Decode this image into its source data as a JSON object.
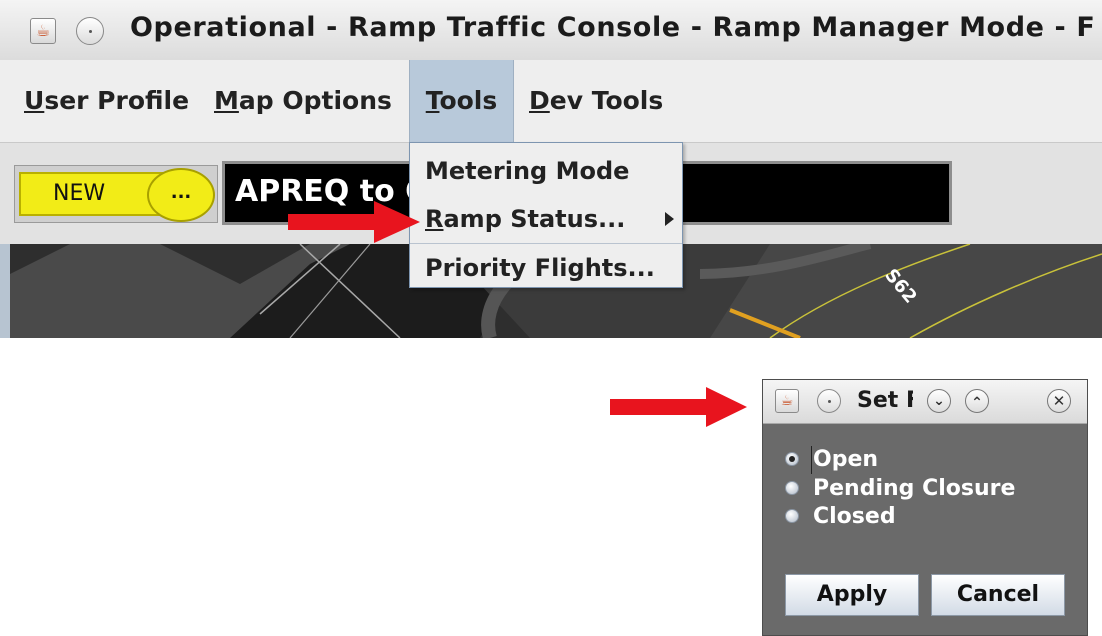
{
  "console": {
    "title": "Operational - Ramp Traffic Console - Ramp Manager Mode - F",
    "menubar": {
      "user_profile": {
        "mnemonic": "U",
        "rest": "ser Profile"
      },
      "map_options": {
        "mnemonic": "M",
        "rest": "ap Options"
      },
      "tools": {
        "mnemonic": "T",
        "rest": "ools"
      },
      "dev_tools": {
        "mnemonic": "D",
        "rest": "ev Tools"
      }
    },
    "tools_menu": {
      "metering_mode": "Metering Mode",
      "ramp_status": {
        "mnemonic": "R",
        "rest": "amp Status..."
      },
      "priority_flights": "Priority Flights..."
    },
    "toolbar": {
      "new_label": "NEW",
      "more_label": "...",
      "message": "APREQ to C"
    },
    "map": {
      "taxiway_label": "S62",
      "line_color": "#c9c23a",
      "highlight_color": "#e0a020"
    }
  },
  "dialog": {
    "title": "Set F",
    "options": [
      "Open",
      "Pending Closure",
      "Closed"
    ],
    "selected": "Open",
    "apply_label": "Apply",
    "cancel_label": "Cancel"
  },
  "annotations": {
    "arrow_color": "#e8141e"
  }
}
